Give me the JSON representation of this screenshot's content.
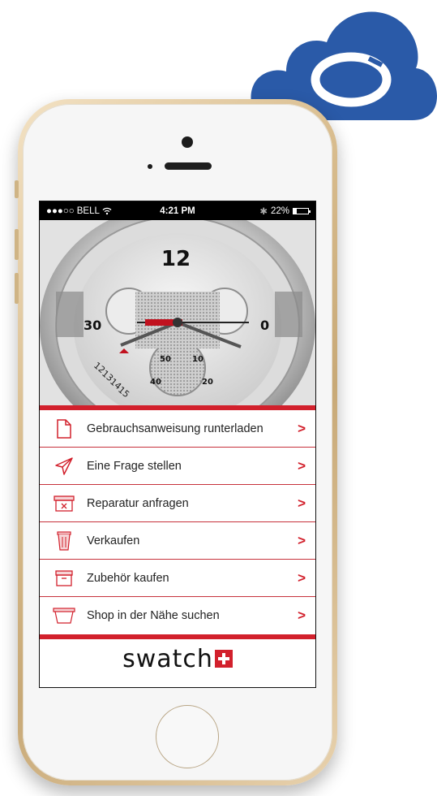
{
  "status_bar": {
    "signal": "●●●○○",
    "carrier": "BELL",
    "wifi_icon": "wifi-icon",
    "time": "4:21 PM",
    "bluetooth": "✱",
    "battery_percent": "22%",
    "battery_level": 0.22
  },
  "hero": {
    "watch_numbers": [
      "12",
      "30",
      "0",
      "50",
      "10",
      "40",
      "20",
      "12",
      "13",
      "14",
      "15"
    ]
  },
  "menu": {
    "items": [
      {
        "label": "Gebrauchsanweisung runterladen",
        "icon": "document-icon"
      },
      {
        "label": "Eine Frage stellen",
        "icon": "paper-plane-icon"
      },
      {
        "label": "Reparatur anfragen",
        "icon": "repair-box-icon"
      },
      {
        "label": "Verkaufen",
        "icon": "trash-icon"
      },
      {
        "label": "Zubehör kaufen",
        "icon": "box-icon"
      },
      {
        "label": "Shop in der Nähe suchen",
        "icon": "shop-bag-icon"
      }
    ],
    "chevron": ">"
  },
  "brand": {
    "name": "swatch"
  },
  "colors": {
    "accent": "#d2202c",
    "cloud": "#2a5aa8"
  }
}
